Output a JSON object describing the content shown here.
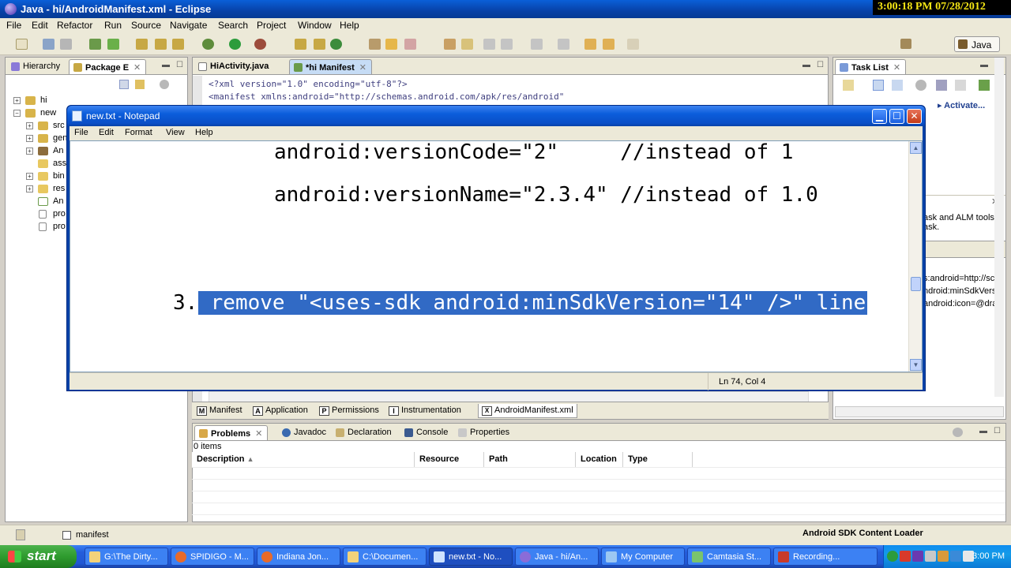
{
  "eclipse": {
    "title": "Java - hi/AndroidManifest.xml - Eclipse",
    "clock": "3:00:18 PM 07/28/2012",
    "menu": [
      "File",
      "Edit",
      "Refactor",
      "Run",
      "Source",
      "Navigate",
      "Search",
      "Project",
      "Window",
      "Help"
    ],
    "perspective": "Java",
    "left_tabs": {
      "hierarchy": "Hierarchy",
      "package": "Package E"
    },
    "tree": [
      {
        "label": "hi",
        "expander": "+",
        "icon": "project-folder-icon"
      },
      {
        "label": "new",
        "expander": "−",
        "icon": "project-folder-icon"
      },
      {
        "label": "src",
        "expander": "+",
        "icon": "source-folder-icon"
      },
      {
        "label": "gen",
        "expander": "+",
        "icon": "source-folder-icon"
      },
      {
        "label": "An",
        "expander": "+",
        "icon": "library-icon"
      },
      {
        "label": "ass",
        "expander": "",
        "icon": "folder-icon"
      },
      {
        "label": "bin",
        "expander": "+",
        "icon": "folder-icon"
      },
      {
        "label": "res",
        "expander": "+",
        "icon": "folder-icon"
      },
      {
        "label": "An",
        "expander": "",
        "icon": "xml-file-icon"
      },
      {
        "label": "pro",
        "expander": "",
        "icon": "file-icon"
      },
      {
        "label": "pro",
        "expander": "",
        "icon": "file-icon"
      }
    ],
    "editor_tabs": [
      "HiActivity.java",
      "*hi Manifest"
    ],
    "editor_lines": [
      "<?xml version=\"1.0\" encoding=\"utf-8\"?>",
      "<manifest xmlns:android=\"http://schemas.android.com/apk/res/android\""
    ],
    "manifest_tabs": [
      "Manifest",
      "Application",
      "Permissions",
      "Instrumentation",
      "AndroidManifest.xml"
    ],
    "manifest_tab_letters": [
      "M",
      "A",
      "P",
      "I",
      "X"
    ],
    "task_list": {
      "title": "Task List",
      "activate": "Activate...",
      "mylyn_text": [
        "ask and ALM tools",
        "ask."
      ]
    },
    "outline_lines": [
      "s:android=http://sc",
      "ndroid:minSdkVersi",
      "android:icon=@dra"
    ],
    "bottom_tabs": [
      "Problems",
      "Javadoc",
      "Declaration",
      "Console",
      "Properties"
    ],
    "problems": {
      "count": "0 items",
      "columns": [
        "Description",
        "Resource",
        "Path",
        "Location",
        "Type"
      ]
    },
    "status": {
      "left": "manifest",
      "right": "Android SDK Content Loader"
    }
  },
  "notepad": {
    "title": "new.txt - Notepad",
    "menu": [
      "File",
      "Edit",
      "Format",
      "View",
      "Help"
    ],
    "lines": [
      "android:versionCode=\"2\"     //instead of 1",
      "android:versionName=\"2.3.4\" //instead of 1.0"
    ],
    "item_number": "3.",
    "selected_text": " remove \"<uses-sdk android:minSdkVersion=\"14\" />\" line",
    "status": "Ln 74, Col 4"
  },
  "taskbar": {
    "start": "start",
    "tasks": [
      {
        "label": "G:\\The Dirty...",
        "color": "#f3d27a"
      },
      {
        "label": "SPIDIGO - M...",
        "color": "#e86a2a"
      },
      {
        "label": "Indiana Jon...",
        "color": "#e86a2a"
      },
      {
        "label": "C:\\Documen...",
        "color": "#f3d27a"
      },
      {
        "label": "new.txt - No...",
        "color": "#cfe3ff"
      },
      {
        "label": "Java - hi/An...",
        "color": "#8a6cd8"
      },
      {
        "label": "My Computer",
        "color": "#9cc7f2"
      },
      {
        "label": "Camtasia St...",
        "color": "#7ac46c"
      },
      {
        "label": "Recording...",
        "color": "#c83a2a"
      }
    ],
    "clock": "3:00 PM"
  }
}
